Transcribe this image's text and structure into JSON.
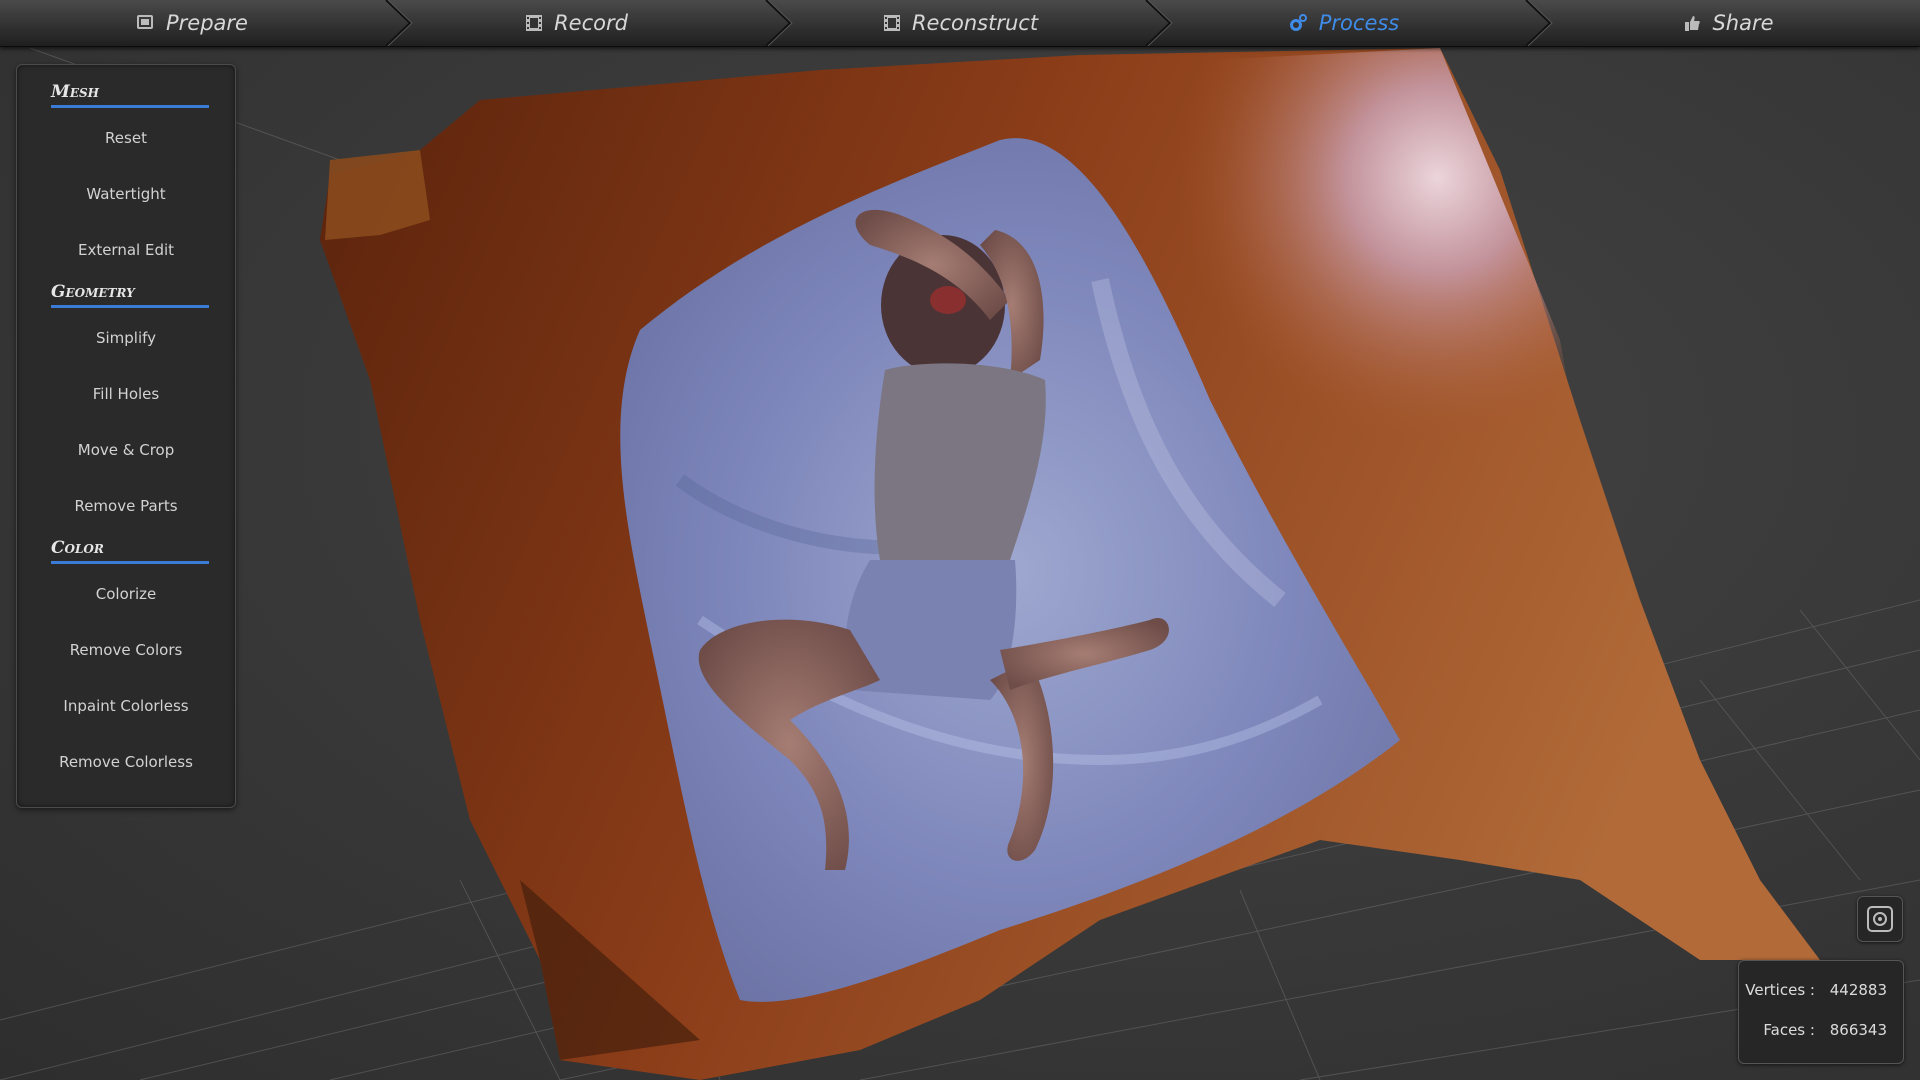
{
  "workflow": {
    "steps": [
      {
        "label": "Prepare",
        "icon": "prepare-icon",
        "active": false
      },
      {
        "label": "Record",
        "icon": "film-icon",
        "active": false
      },
      {
        "label": "Reconstruct",
        "icon": "film-icon",
        "active": false
      },
      {
        "label": "Process",
        "icon": "gears-icon",
        "active": true
      },
      {
        "label": "Share",
        "icon": "thumbs-up-icon",
        "active": false
      }
    ],
    "active_color": "#3f8be8"
  },
  "sidebar": {
    "accent_color": "#3a7bd5",
    "sections": [
      {
        "title": "Mesh",
        "buttons": [
          "Reset",
          "Watertight",
          "External Edit"
        ]
      },
      {
        "title": "Geometry",
        "buttons": [
          "Simplify",
          "Fill Holes",
          "Move & Crop",
          "Remove Parts"
        ]
      },
      {
        "title": "Color",
        "buttons": [
          "Colorize",
          "Remove Colors",
          "Inpaint Colorless",
          "Remove Colorless"
        ]
      }
    ]
  },
  "viewport": {
    "content": "textured-3d-mesh-scan",
    "camera_button_icon": "snapshot-icon"
  },
  "stats": {
    "vertices_label": "Vertices :",
    "vertices_value": "442883",
    "faces_label": "Faces :",
    "faces_value": "866343"
  }
}
